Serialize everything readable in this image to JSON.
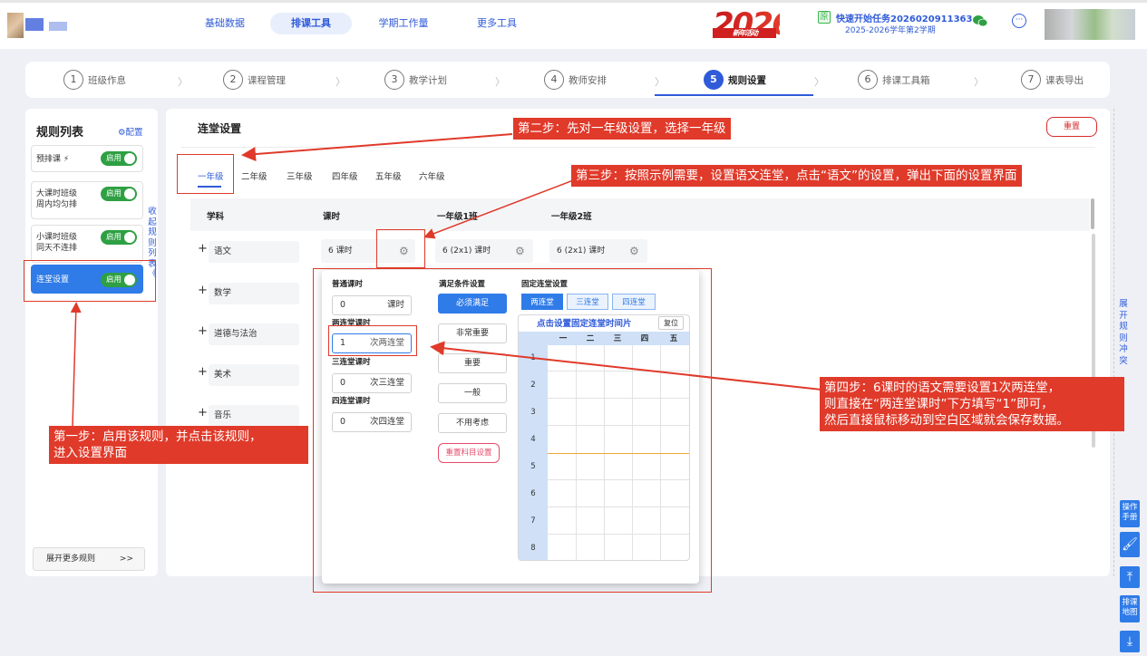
{
  "nav": {
    "items": [
      {
        "label": "基础数据"
      },
      {
        "label": "排课工具"
      },
      {
        "label": "学期工作量"
      },
      {
        "label": "更多工具"
      }
    ]
  },
  "badge": {
    "year": "2026",
    "sub": "新 年 活 动"
  },
  "task": {
    "tag": "原",
    "title": "快速开始任务2026020911363...",
    "term": "2025-2026学年第2学期"
  },
  "steps": [
    {
      "num": "1",
      "label": "班级作息"
    },
    {
      "num": "2",
      "label": "课程管理"
    },
    {
      "num": "3",
      "label": "教学计划"
    },
    {
      "num": "4",
      "label": "教师安排"
    },
    {
      "num": "5",
      "label": "规则设置"
    },
    {
      "num": "6",
      "label": "排课工具箱"
    },
    {
      "num": "7",
      "label": "课表导出"
    }
  ],
  "rules": {
    "title": "规则列表",
    "config": "⚙配置",
    "items": [
      {
        "label": "预排课 ⚡",
        "toggle": "启用"
      },
      {
        "label": "大课时班级\n周内均匀排",
        "toggle": "启用"
      },
      {
        "label": "小课时班级\n同天不连排",
        "toggle": "启用"
      },
      {
        "label": "连堂设置",
        "toggle": "启用"
      }
    ],
    "collapse": "收起规则列表《",
    "more": "展开更多规则",
    "more_arrow": ">>"
  },
  "main": {
    "title": "连堂设置",
    "reset": "重置",
    "grades": [
      "一年级",
      "二年级",
      "三年级",
      "四年级",
      "五年级",
      "六年级"
    ],
    "headers": {
      "subject": "学科",
      "hours": "课时",
      "class1": "一年级1班",
      "class2": "一年级2班"
    },
    "subjects": [
      "语文",
      "数学",
      "道德与法治",
      "美术",
      "音乐"
    ],
    "row1": {
      "hours": "6 课时",
      "class1": "6 (2x1) 课时",
      "class2": "6 (2x1) 课时"
    }
  },
  "popup": {
    "normal_label": "普通课时",
    "normal_value": "0",
    "normal_unit": "课时",
    "two_label": "两连堂课时",
    "two_value": "1",
    "two_unit": "次两连堂",
    "three_label": "三连堂课时",
    "three_value": "0",
    "three_unit": "次三连堂",
    "four_label": "四连堂课时",
    "four_value": "0",
    "four_unit": "次四连堂",
    "cond_title": "满足条件设置",
    "conditions": [
      "必须满足",
      "非常重要",
      "重要",
      "一般",
      "不用考虑"
    ],
    "cond_reset": "重置科目设置",
    "fix_title": "固定连堂设置",
    "fix_tabs": [
      "两连堂",
      "三连堂",
      "四连堂"
    ],
    "tt_title": "点击设置固定连堂时间片",
    "tt_reset": "复位",
    "days": [
      "一",
      "二",
      "三",
      "四",
      "五"
    ],
    "periods": [
      "1",
      "2",
      "3",
      "4",
      "5",
      "6",
      "7",
      "8"
    ]
  },
  "annotations": {
    "step1": "第一步：启用该规则，并点击该规则，\n进入设置界面",
    "step2": "第二步：先对一年级设置，选择一年级",
    "step3": "第三步：按照示例需要，设置语文连堂，点击“语文”的设置，弹出下面的设置界面",
    "step4": "第四步：6课时的语文需要设置1次两连堂，\n则直接在“两连堂课时”下方填写“1”即可，\n然后直接鼠标移动到空白区域就会保存数据。"
  },
  "right": {
    "expand": "展开规则冲突",
    "manual": "操作手册",
    "map": "排课地图"
  },
  "colors": {
    "primary": "#2f5bd8",
    "toggle": "#2ea043",
    "annotation": "#e03a2a"
  }
}
